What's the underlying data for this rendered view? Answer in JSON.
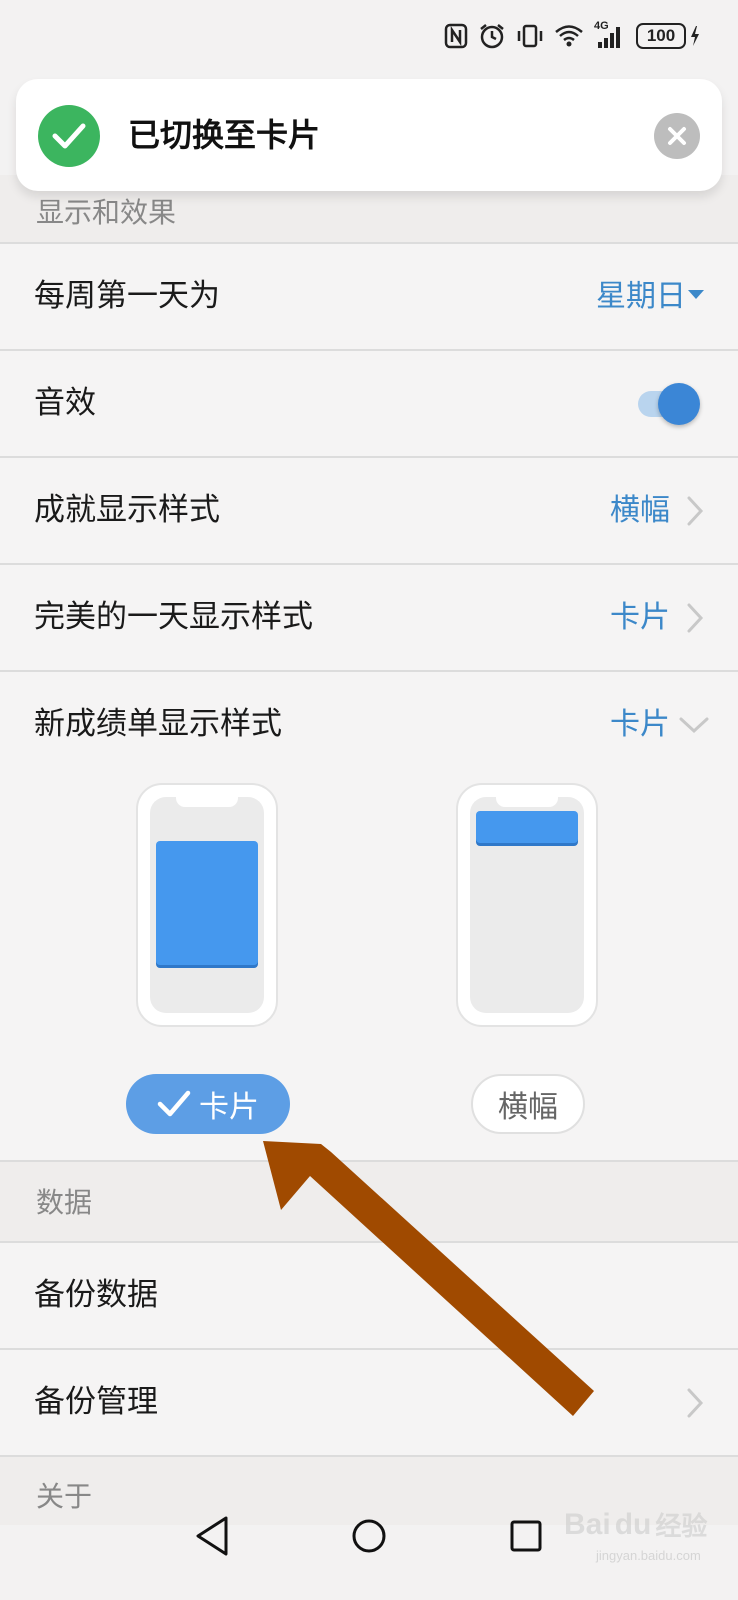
{
  "status_bar": {
    "icons": [
      "nfc-icon",
      "alarm-icon",
      "vibrate-icon",
      "wifi-icon",
      "signal-4g-icon"
    ],
    "network_label": "4G",
    "battery_level": "100"
  },
  "toast": {
    "message": "已切换至卡片"
  },
  "sections": {
    "display": "显示和效果",
    "data": "数据",
    "about": "关于"
  },
  "settings": {
    "week_start": {
      "label": "每周第一天为",
      "value": "星期日"
    },
    "sound": {
      "label": "音效",
      "enabled": true
    },
    "achievement_style": {
      "label": "成就显示样式",
      "value": "横幅"
    },
    "perfect_day_style": {
      "label": "完美的一天显示样式",
      "value": "卡片"
    },
    "report_style": {
      "label": "新成绩单显示样式",
      "value": "卡片"
    }
  },
  "style_picker": {
    "options": [
      {
        "label": "卡片",
        "selected": true
      },
      {
        "label": "横幅",
        "selected": false
      }
    ]
  },
  "data_rows": {
    "backup": "备份数据",
    "backup_manage": "备份管理"
  },
  "watermark": {
    "brand": "Bai",
    "brand_suffix": "du",
    "sub": "经验",
    "url": "jingyan.baidu.com"
  },
  "colors": {
    "accent": "#3c88c9",
    "toggle_on": "#3b86d6",
    "success": "#3cb55f",
    "card_blue": "#4598ee",
    "annotation_arrow": "#a04a00"
  }
}
